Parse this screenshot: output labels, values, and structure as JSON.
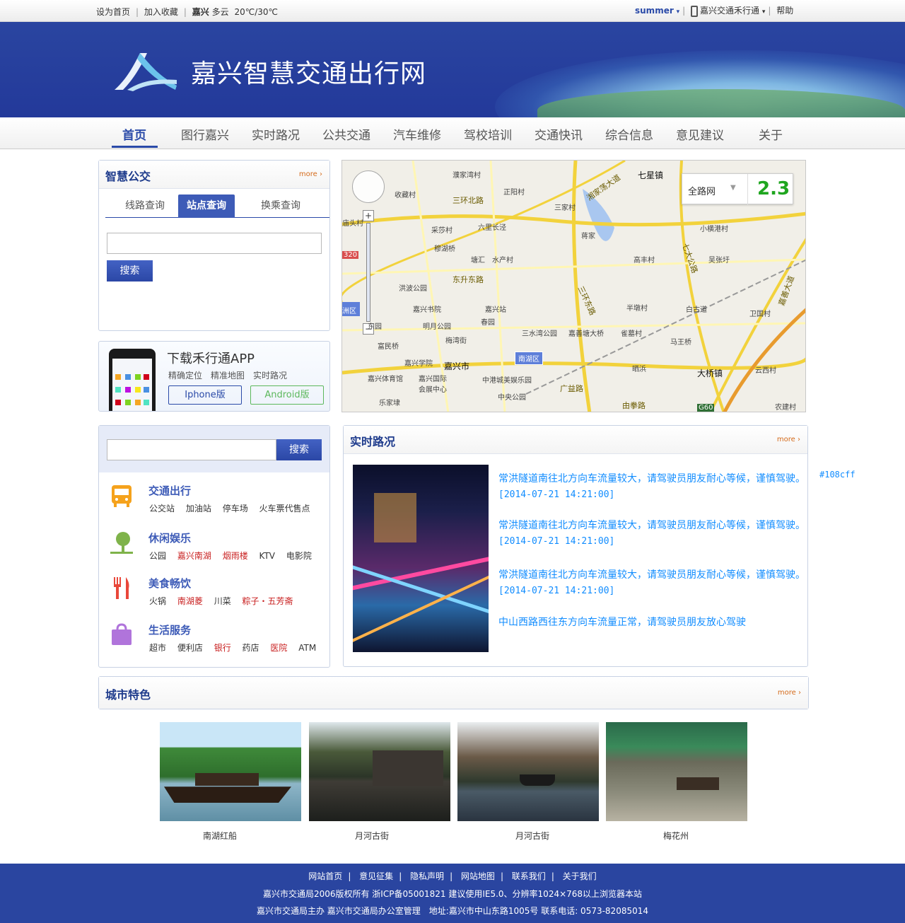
{
  "topbar": {
    "left_links": [
      "设为首页",
      "加入收藏"
    ],
    "city": "嘉兴",
    "weather": "多云",
    "temperature": "20℃/30℃",
    "user": "summer",
    "app_link": "嘉兴交通禾行通",
    "help": "帮助"
  },
  "banner": {
    "title": "嘉兴智慧交通出行网"
  },
  "nav": {
    "items": [
      "首页",
      "图行嘉兴",
      "实时路况",
      "公共交通",
      "汽车维修",
      "驾校培训",
      "交通快讯",
      "综合信息",
      "意见建议",
      "关于"
    ],
    "active": "首页"
  },
  "bus_panel": {
    "title": "智慧公交",
    "more": "more",
    "tabs": [
      "线路查询",
      "站点查询",
      "换乘查询"
    ],
    "active_tab": "站点查询",
    "search_value": "",
    "search_button": "搜索"
  },
  "app_panel": {
    "title": "下载禾行通APP",
    "features": "精确定位　精准地图　实时路况",
    "iphone_button": "Iphone版",
    "android_button": "Android版"
  },
  "map": {
    "network_select": "全路网",
    "index_value": "2.3",
    "labels": {
      "l1": "濮家湾村",
      "l2": "七星镇",
      "l3": "收藏村",
      "l4": "正阳村",
      "l5": "三环北路",
      "l6": "湘家荡大道",
      "l7": "三家村",
      "l8": "小横港村",
      "l9": "庙头村",
      "l10": "采莎村",
      "l11": "六里长泾",
      "l12": "蒋家",
      "l13": "穆湖桥",
      "l14": "塘汇",
      "l15": "水产村",
      "l16": "高丰村",
      "l17": "吴张圩",
      "l18": "七大公路",
      "l19": "东升东路",
      "l20": "洪波公园",
      "l21": "三环东路",
      "l22": "嘉兴书院",
      "l23": "嘉兴站",
      "l24": "半墩村",
      "l25": "白古道",
      "l26": "卫国村",
      "l27": "明月公园",
      "l28": "春园",
      "l29": "三水湾公园",
      "l30": "嘉善塘大桥",
      "l31": "雀墓村",
      "l32": "富民桥",
      "l33": "梅湾街",
      "l34": "马王桥",
      "l35": "南湖区",
      "l36": "嘉兴学院",
      "l37": "嘉兴市",
      "l38": "晒浜",
      "l39": "大桥镇",
      "l40": "云西村",
      "l41": "嘉兴体育馆",
      "l42": "嘉兴国际会展中心",
      "l43": "中港城美娱乐园",
      "l44": "广益路",
      "l45": "中央公园",
      "l46": "乐家埭",
      "l47": "由拳路",
      "l48": "农建村",
      "l49": "嘉善大道",
      "l50": "320",
      "l51": "洲区",
      "l52": "G60",
      "l53": "东园"
    }
  },
  "search_panel": {
    "search_value": "",
    "search_button": "搜索",
    "categories": [
      {
        "name": "交通出行",
        "icon": "bus-icon",
        "links": [
          {
            "t": "公交站"
          },
          {
            "t": "加油站"
          },
          {
            "t": "停车场"
          },
          {
            "t": "火车票代售点"
          }
        ]
      },
      {
        "name": "休闲娱乐",
        "icon": "tree-icon",
        "links": [
          {
            "t": "公园"
          },
          {
            "t": "嘉兴南湖",
            "red": true
          },
          {
            "t": "烟雨楼",
            "red": true
          },
          {
            "t": "KTV"
          },
          {
            "t": "电影院"
          }
        ]
      },
      {
        "name": "美食畅饮",
        "icon": "cutlery-icon",
        "links": [
          {
            "t": "火锅"
          },
          {
            "t": "南湖菱",
            "red": true
          },
          {
            "t": "川菜"
          },
          {
            "t": "粽子・五芳斋",
            "red": true
          }
        ]
      },
      {
        "name": "生活服务",
        "icon": "shopping-bag-icon",
        "links": [
          {
            "t": "超市"
          },
          {
            "t": "便利店"
          },
          {
            "t": "银行",
            "red": true
          },
          {
            "t": "药店"
          },
          {
            "t": "医院",
            "red": true
          },
          {
            "t": "ATM"
          }
        ]
      }
    ]
  },
  "traffic_panel": {
    "title": "实时路况",
    "more": "more",
    "color_note": "#108cff",
    "news": [
      {
        "text": "常洪隧道南往北方向车流量较大，请驾驶员朋友耐心等候，谨慎驾驶。",
        "time": "[2014-07-21 14:21:00]"
      },
      {
        "text": "常洪隧道南往北方向车流量较大，请驾驶员朋友耐心等候，谨慎驾驶。",
        "time": "[2014-07-21 14:21:00]"
      },
      {
        "text": "常洪隧道南往北方向车流量较大，请驾驶员朋友耐心等候，谨慎驾驶。",
        "time": "[2014-07-21 14:21:00]"
      },
      {
        "text": "中山西路西往东方向车流量正常，请驾驶员朋友放心驾驶",
        "time": ""
      }
    ]
  },
  "city_panel": {
    "title": "城市特色",
    "more": "more",
    "photos": [
      "南湖红船",
      "月河古街",
      "月河古街",
      "梅花州"
    ]
  },
  "footer": {
    "links": [
      "网站首页",
      "意见征集",
      "隐私声明",
      "网站地图",
      "联系我们",
      "关于我们"
    ],
    "copyright": "嘉兴市交通局2006版权所有 浙ICP备05001821 建议使用IE5.0、分辨率1024×768以上浏览器本站",
    "contact": "嘉兴市交通局主办 嘉兴市交通局办公室管理　地址:嘉兴市中山东路1005号 联系电话: 0573-82085014"
  },
  "colors": {
    "brand": "#2a45a0",
    "accent": "#3d5bb7",
    "link": "#108cff",
    "more": "#d46a1a",
    "red_link": "#c81e1e"
  }
}
